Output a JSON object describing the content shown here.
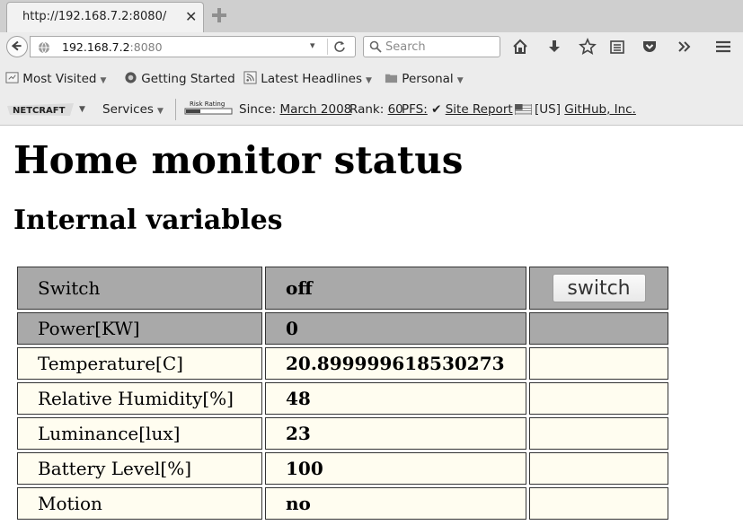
{
  "browser": {
    "tab_title": "http://192.168.7.2:8080/",
    "tab_close": "✕",
    "url_host": "192.168.7.2",
    "url_port": ":8080",
    "search_placeholder": "Search",
    "url_dropdown": "▾",
    "url_reload": "C"
  },
  "bookmarks": [
    {
      "label": "Most Visited",
      "has_arrow": true
    },
    {
      "label": "Getting Started",
      "has_arrow": false
    },
    {
      "label": "Latest Headlines",
      "has_arrow": true
    },
    {
      "label": "Personal",
      "has_arrow": true
    }
  ],
  "netcraft": {
    "logo": "NETCRAFT",
    "services": "Services",
    "risk_label": "Risk Rating",
    "since_label": "Since:",
    "since_value": "March 2008",
    "rank_label": "Rank:",
    "rank_value": "60",
    "pfs_label": "PFS:",
    "pfs_check": "✔",
    "site_report": "Site Report",
    "country": "[US]",
    "company": "GitHub, Inc."
  },
  "page": {
    "title": "Home monitor status",
    "subtitle": "Internal variables",
    "switch_button": "switch",
    "rows": [
      {
        "name": "Switch",
        "value": "off"
      },
      {
        "name": "Power[KW]",
        "value": "0"
      },
      {
        "name": "Temperature[C]",
        "value": "20.899999618530273"
      },
      {
        "name": "Relative Humidity[%]",
        "value": "48"
      },
      {
        "name": "Luminance[lux]",
        "value": "23"
      },
      {
        "name": "Battery Level[%]",
        "value": "100"
      },
      {
        "name": "Motion",
        "value": "no"
      }
    ]
  },
  "colors": {
    "control_rows": "#a9a9a9",
    "sensor_rows": "#fffdf0"
  }
}
